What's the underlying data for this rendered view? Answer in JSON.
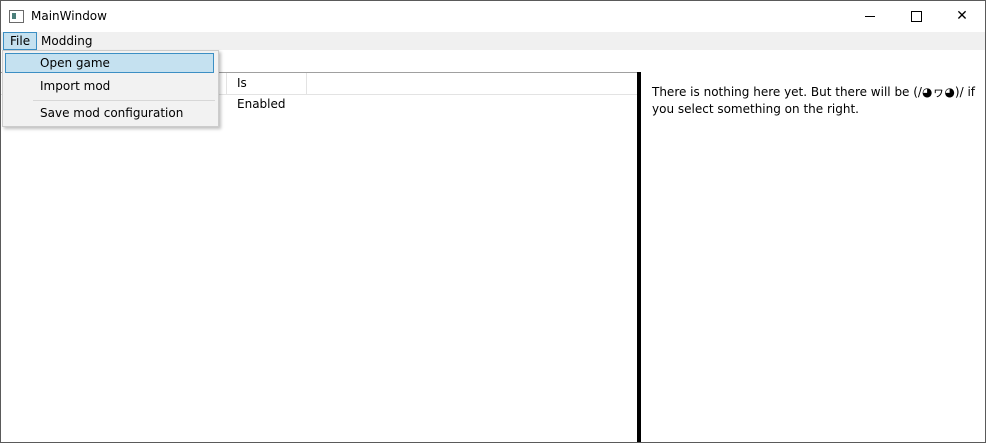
{
  "window": {
    "title": "MainWindow",
    "app_icon": "window-app-icon",
    "caption_buttons": {
      "minimize": "minimize-icon",
      "maximize": "maximize-icon",
      "close": "✕"
    }
  },
  "menubar": {
    "items": [
      {
        "label": "File"
      },
      {
        "label": "Modding"
      }
    ]
  },
  "file_menu": {
    "items": [
      {
        "label": "Open game"
      },
      {
        "label": "Import mod"
      },
      {
        "label": "Save mod configuration"
      }
    ]
  },
  "grid": {
    "columns": [
      {
        "label": ""
      },
      {
        "label": "Is Enabled"
      }
    ]
  },
  "details": {
    "message": "There is nothing here yet. But there will be (/◕ヮ◕)/ if you select something on the right."
  },
  "colors": {
    "menu_highlight": "#c5e1f0",
    "menu_highlight_border": "#3c8fc4",
    "menubar_bg": "#f0f0f0",
    "splitter": "#000000"
  }
}
